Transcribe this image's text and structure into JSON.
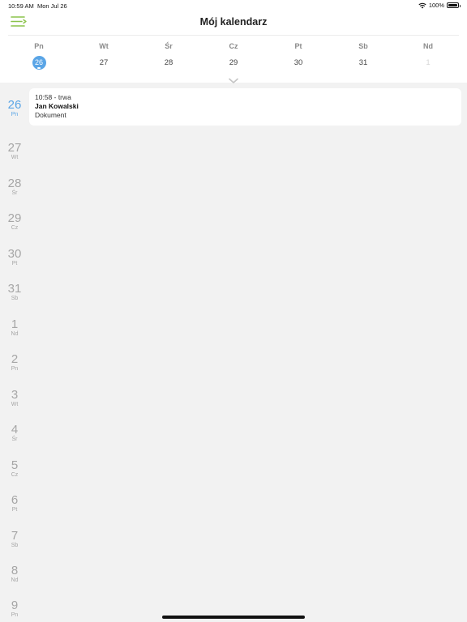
{
  "status_bar": {
    "time": "10:59 AM",
    "date": "Mon Jul 26",
    "battery": "100%",
    "icons": [
      "wifi-icon",
      "battery-icon"
    ]
  },
  "header": {
    "title": "Mój kalendarz",
    "menu_icon": "menu-icon",
    "accent_color": "#8bc34a"
  },
  "week": {
    "weekdays": [
      "Pn",
      "Wt",
      "Śr",
      "Cz",
      "Pt",
      "Sb",
      "Nd"
    ],
    "dates": [
      "26",
      "27",
      "28",
      "29",
      "30",
      "31",
      "1"
    ],
    "selected_index": 0,
    "selected_color": "#5aa5e6",
    "expand_icon": "chevron-down-icon"
  },
  "days": [
    {
      "num": "26",
      "abbr": "Pn",
      "today": true
    },
    {
      "num": "27",
      "abbr": "Wt"
    },
    {
      "num": "28",
      "abbr": "Śr"
    },
    {
      "num": "29",
      "abbr": "Cz"
    },
    {
      "num": "30",
      "abbr": "Pt"
    },
    {
      "num": "31",
      "abbr": "Sb"
    },
    {
      "num": "1",
      "abbr": "Nd"
    },
    {
      "num": "2",
      "abbr": "Pn"
    },
    {
      "num": "3",
      "abbr": "Wt"
    },
    {
      "num": "4",
      "abbr": "Śr"
    },
    {
      "num": "5",
      "abbr": "Cz"
    },
    {
      "num": "6",
      "abbr": "Pt"
    },
    {
      "num": "7",
      "abbr": "Sb"
    },
    {
      "num": "8",
      "abbr": "Nd"
    },
    {
      "num": "9",
      "abbr": "Pn"
    }
  ],
  "event": {
    "time": "10:58 - trwa",
    "name": "Jan Kowalski",
    "type": "Dokument"
  }
}
